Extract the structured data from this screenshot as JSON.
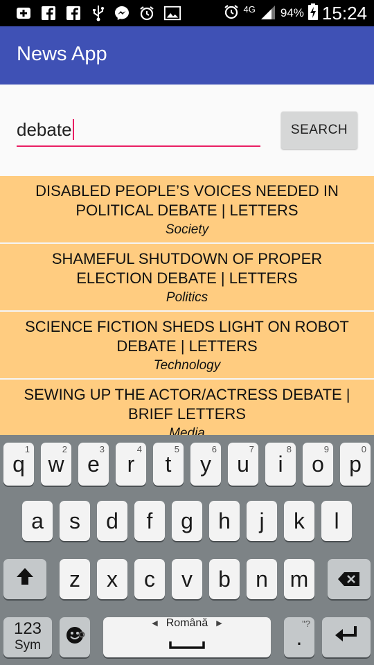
{
  "status_bar": {
    "left_icons": [
      "plus-box-icon",
      "facebook-icon",
      "facebook-icon",
      "usb-icon",
      "messenger-icon",
      "alarm-icon",
      "image-icon"
    ],
    "alarm_icon": "alarm-icon",
    "network": "4G",
    "battery": "94%",
    "time": "15:24"
  },
  "app_bar": {
    "title": "News App",
    "color": "#3f51b5"
  },
  "search": {
    "value": "debate",
    "button_label": "SEARCH",
    "accent": "#e91e63"
  },
  "results": [
    {
      "title": "DISABLED PEOPLE’S VOICES NEEDED IN POLITICAL DEBATE | LETTERS",
      "section": "Society"
    },
    {
      "title": "SHAMEFUL SHUTDOWN OF PROPER ELECTION DEBATE | LETTERS",
      "section": "Politics"
    },
    {
      "title": "SCIENCE FICTION SHEDS LIGHT ON ROBOT DEBATE | LETTERS",
      "section": "Technology"
    },
    {
      "title": "SEWING UP THE ACTOR/ACTRESS DEBATE | BRIEF LETTERS",
      "section": "Media"
    }
  ],
  "result_bg": "#ffcc80",
  "keyboard": {
    "row1": [
      {
        "k": "q",
        "n": "1"
      },
      {
        "k": "w",
        "n": "2"
      },
      {
        "k": "e",
        "n": "3"
      },
      {
        "k": "r",
        "n": "4"
      },
      {
        "k": "t",
        "n": "5"
      },
      {
        "k": "y",
        "n": "6"
      },
      {
        "k": "u",
        "n": "7"
      },
      {
        "k": "i",
        "n": "8"
      },
      {
        "k": "o",
        "n": "9"
      },
      {
        "k": "p",
        "n": "0"
      }
    ],
    "row2": [
      "a",
      "s",
      "d",
      "f",
      "g",
      "h",
      "j",
      "k",
      "l"
    ],
    "row3": [
      "z",
      "x",
      "c",
      "v",
      "b",
      "n",
      "m"
    ],
    "symbols_top": "123",
    "symbols_bottom": "Sym",
    "language": "Română",
    "period": ".",
    "period_hint": "\"?"
  }
}
